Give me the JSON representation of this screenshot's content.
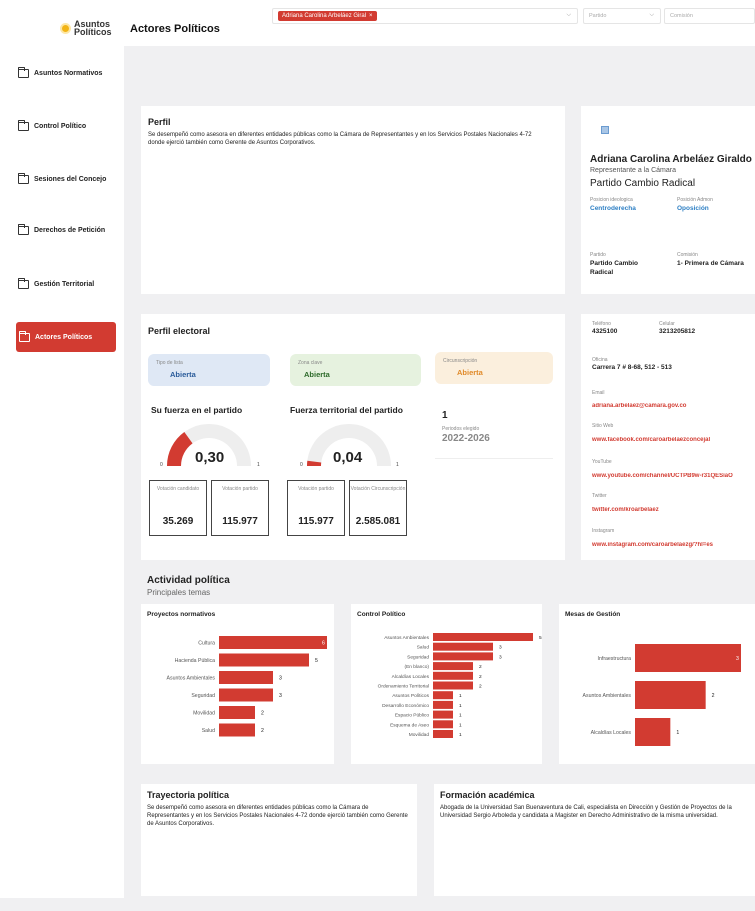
{
  "logo": {
    "name_line1": "Asuntos",
    "name_line2": "Políticos"
  },
  "sidebar": {
    "items": [
      {
        "label": "Asuntos Normativos"
      },
      {
        "label": "Control Político"
      },
      {
        "label": "Sesiones del Concejo"
      },
      {
        "label": "Derechos de Petición"
      },
      {
        "label": "Gestión Territorial"
      },
      {
        "label": "Actores Políticos"
      }
    ]
  },
  "header": {
    "title": "Actores Políticos",
    "filter_actor_chip": "Adriana Carolina Arbeláez Giral",
    "filter_party_placeholder": "Partido",
    "filter_commission_placeholder": "Comisión"
  },
  "profile": {
    "heading": "Perfil",
    "text": "Se desempeñó como asesora en diferentes entidades públicas como la Cámara de Representantes y en los Servicios Postales Nacionales 4-72 donde ejerció también como Gerente de Asuntos Corporativos."
  },
  "person": {
    "name": "Adriana Carolina Arbeláez Giraldo",
    "role": "Representante a la Cámara",
    "party": "Partido Cambio Radical",
    "ideology_label": "Posicion ideologica",
    "ideology_value": "Centroderecha",
    "admin_label": "Posición Admon",
    "admin_value": "Oposición",
    "party_label": "Partido",
    "party_value": "Partido Cambio Radical",
    "commission_label": "Comisión",
    "commission_value": "1- Primera de Cámara"
  },
  "electoral": {
    "heading": "Perfil electoral",
    "list_type_label": "Tipo de lista",
    "list_type_value": "Abierta",
    "key_zone_label": "Zona clave",
    "key_zone_value": "Abierta",
    "district_label": "Circunscripción",
    "district_value": "Abierta",
    "gauge1": {
      "title": "Su fuerza en el partido",
      "value": 0.3,
      "display": "0,30",
      "min": "0",
      "max": "1"
    },
    "gauge2": {
      "title": "Fuerza territorial del partido",
      "value": 0.04,
      "display": "0,04",
      "min": "0",
      "max": "1"
    },
    "periods_count": "1",
    "periods_label": "Periodos elegido",
    "periods_value": "2022-2026",
    "stat1": {
      "label": "Votación candidato",
      "value": "35.269"
    },
    "stat2": {
      "label": "Votación partido",
      "value": "115.977"
    },
    "stat3": {
      "label": "Votación partido",
      "value": "115.977"
    },
    "stat4": {
      "label": "Votación Circunscripción",
      "value": "2.585.081"
    }
  },
  "contact": {
    "phone_label": "Teléfono",
    "phone_value": "4325100",
    "cell_label": "Celular",
    "cell_value": "3213205812",
    "office_label": "Oficina",
    "office_value": "Carrera 7 # 8-68, 512 - 513",
    "email_label": "Email",
    "email_value": "adriana.arbelaez@camara.gov.co",
    "web_label": "Sitio Web",
    "web_value": "www.facebook.com/caroarbelaezconcejal",
    "youtube_label": "YouTube",
    "youtube_value": "www.youtube.com/channel/UCTPB9w-r31QESiaO",
    "twitter_label": "Twitter",
    "twitter_value": "twitter.com/kroarbelaez",
    "instagram_label": "Instagram",
    "instagram_value": "www.instagram.com/caroarbelaezg/?hl=es"
  },
  "activity": {
    "title": "Actividad política",
    "subtitle": "Principales temas"
  },
  "chart_data": [
    {
      "type": "bar",
      "orientation": "horizontal",
      "title": "Proyectos normativos",
      "categories": [
        "Cultura",
        "Hacienda Pública",
        "Asuntos Ambientales",
        "Seguridad",
        "Movilidad",
        "Salud"
      ],
      "values": [
        6,
        5,
        3,
        3,
        2,
        2
      ],
      "xlim": [
        0,
        6
      ],
      "color": "#d23b31"
    },
    {
      "type": "bar",
      "orientation": "horizontal",
      "title": "Control Político",
      "categories": [
        "Asuntos Ambientales",
        "Salud",
        "Seguridad",
        "(En blanco)",
        "Alcaldías Locales",
        "Ordenamiento Territorial",
        "Asuntos Políticos",
        "Desarrollo Económico",
        "Espacio Público",
        "Esquema de Aseo",
        "Movilidad"
      ],
      "values": [
        5,
        3,
        3,
        2,
        2,
        2,
        1,
        1,
        1,
        1,
        1
      ],
      "xlim": [
        0,
        5
      ],
      "color": "#d23b31"
    },
    {
      "type": "bar",
      "orientation": "horizontal",
      "title": "Mesas de Gestión",
      "categories": [
        "Infraestructura",
        "Asuntos Ambientales",
        "Alcaldías Locales"
      ],
      "values": [
        3,
        2,
        1
      ],
      "xlim": [
        0,
        3
      ],
      "color": "#d23b31"
    }
  ],
  "trajectory": {
    "heading": "Trayectoria política",
    "text": "Se desempeñó como asesora en diferentes entidades públicas como la Cámara de Representantes y en los Servicios Postales Nacionales 4-72 donde ejerció también como Gerente de Asuntos Corporativos."
  },
  "education": {
    "heading": "Formación académica",
    "text": "Abogada de la Universidad San Buenaventura de Cali, especialista en Dirección y Gestión de Proyectos de la Universidad Sergio Arboleda y candidata a Magister en Derecho Administrativo de la misma universidad."
  },
  "colors": {
    "accent": "#d23b31",
    "blue": "#2d7fc4",
    "gauge_track": "#eeeeee"
  }
}
